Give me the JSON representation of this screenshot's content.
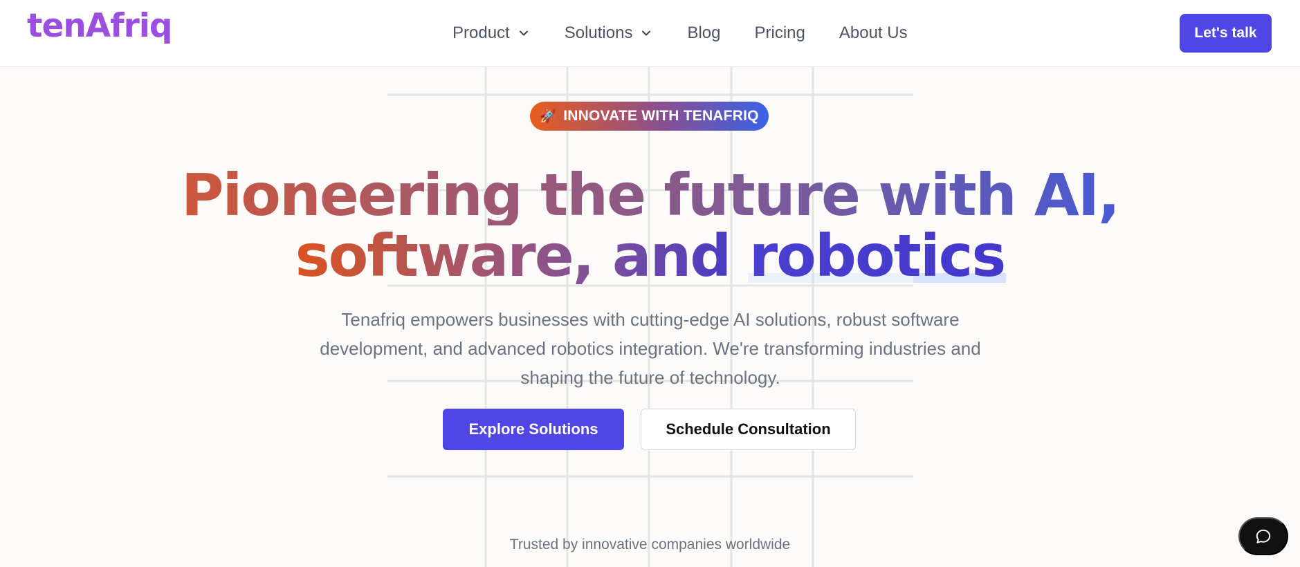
{
  "brand": {
    "logo_text": "tenAfriq"
  },
  "nav": {
    "items": [
      {
        "label": "Product",
        "has_dropdown": true,
        "icon": "chevron-down-icon"
      },
      {
        "label": "Solutions",
        "has_dropdown": true,
        "icon": "chevron-down-icon"
      },
      {
        "label": "Blog",
        "has_dropdown": false
      },
      {
        "label": "Pricing",
        "has_dropdown": false
      },
      {
        "label": "About Us",
        "has_dropdown": false
      }
    ],
    "cta_label": "Let's talk"
  },
  "hero": {
    "badge_icon": "rocket-icon",
    "badge_icon_glyph": "🚀",
    "badge_label": "INNOVATE WITH TENAFRIQ",
    "headline_line1": "Pioneering the future with AI,",
    "headline_line2_part1": "software, and ",
    "headline_line2_part2": "robotics",
    "subtitle": "Tenafriq empowers businesses with cutting-edge AI solutions, robust software development, and advanced robotics integration. We're transforming industries and shaping the future of technology.",
    "primary_button": "Explore Solutions",
    "secondary_button": "Schedule Consultation",
    "trusted_text": "Trusted by innovative companies worldwide"
  },
  "chat": {
    "icon": "chat-bubble-icon"
  },
  "colors": {
    "brand_purple": "#9b4fe0",
    "accent_indigo": "#4f46e5",
    "gradient_orange": "#e8561a",
    "gradient_blue": "#3e3acb"
  }
}
